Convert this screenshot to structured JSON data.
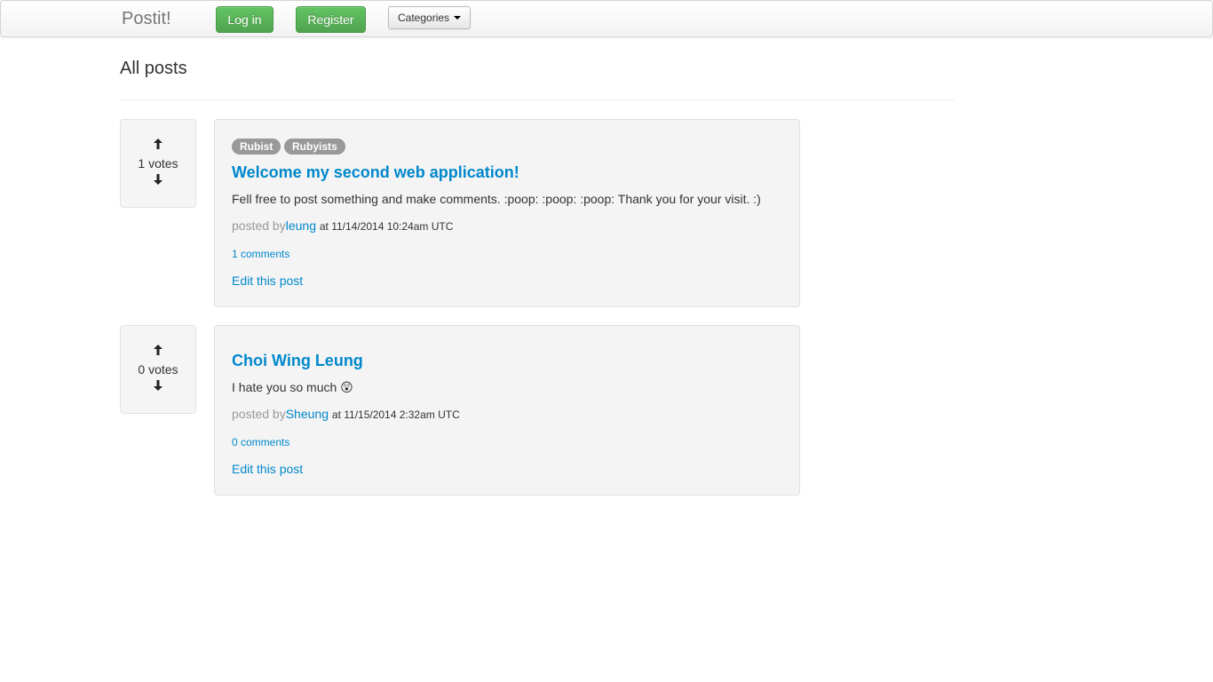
{
  "navbar": {
    "brand": "Postit!",
    "login_label": "Log in",
    "register_label": "Register",
    "categories_label": "Categories"
  },
  "page": {
    "title": "All posts"
  },
  "posts": [
    {
      "votes": "1 votes",
      "categories": [
        "Rubist",
        "Rubyists"
      ],
      "title": "Welcome my second web application!",
      "body": "Fell free to post something and make comments. :poop: :poop: :poop: Thank you for your visit. :)",
      "posted_by_prefix": "posted by",
      "author": "leung",
      "timestamp": "at 11/14/2014 10:24am UTC",
      "comments_label": "1 comments",
      "edit_label": "Edit this post"
    },
    {
      "votes": "0 votes",
      "categories": [],
      "title": "Choi Wing Leung",
      "body": "I hate you so much 😲",
      "posted_by_prefix": "posted by",
      "author": "Sheung",
      "timestamp": "at 11/15/2014 2:32am UTC",
      "comments_label": "0 comments",
      "edit_label": "Edit this post"
    }
  ],
  "icons": {
    "vote_up": "arrow-up-icon",
    "vote_down": "arrow-down-icon",
    "dropdown": "caret-down-icon"
  },
  "colors": {
    "link": "#0088cc",
    "success_button": "#5bb75b",
    "badge": "#999999"
  }
}
